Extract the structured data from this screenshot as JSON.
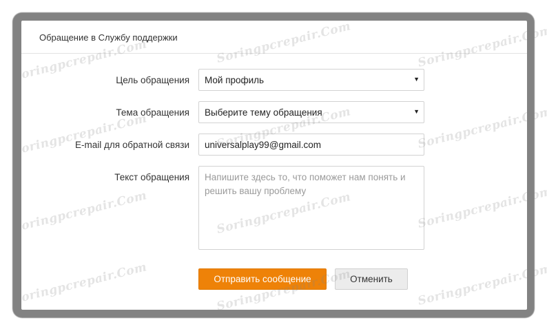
{
  "dialog": {
    "title": "Обращение в Службу поддержки"
  },
  "form": {
    "purpose": {
      "label": "Цель обращения",
      "value": "Мой профиль"
    },
    "topic": {
      "label": "Тема обращения",
      "value": "Выберите тему обращения"
    },
    "email": {
      "label": "E-mail для обратной связи",
      "value": "universalplay99@gmail.com"
    },
    "message": {
      "label": "Текст обращения",
      "placeholder": "Напишите здесь то, что поможет нам понять и решить вашу проблему"
    }
  },
  "buttons": {
    "submit": "Отправить сообщение",
    "cancel": "Отменить"
  },
  "watermark": "Soringpcrepair.Com",
  "colors": {
    "accent": "#ee8208",
    "frame": "#5f5f5f"
  }
}
